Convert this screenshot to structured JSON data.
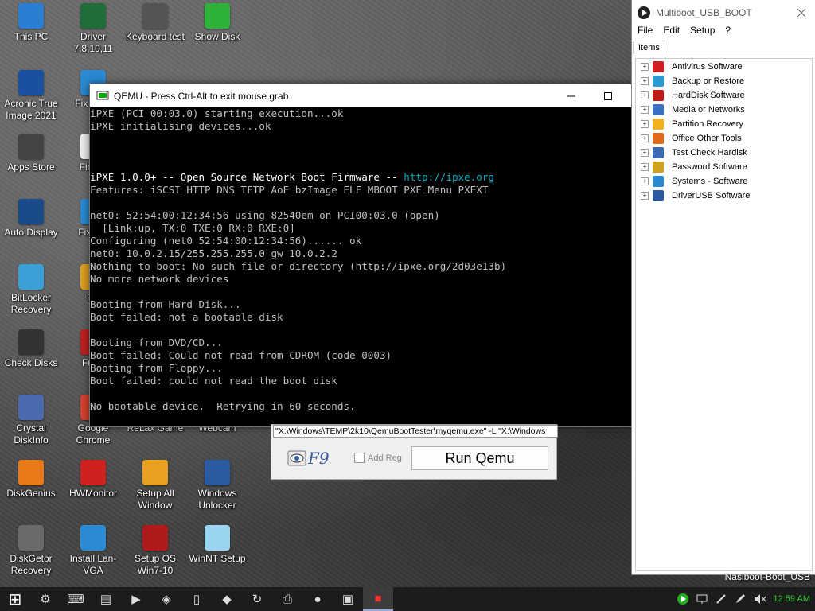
{
  "desktop_icons": [
    {
      "label": "This PC",
      "icon": "computer-icon",
      "color": "#2a7fd4"
    },
    {
      "label": "Driver 7,8,10,11",
      "icon": "driver-icon",
      "color": "#1f6e3a"
    },
    {
      "label": "Keyboard test",
      "icon": "keyboard-test-icon",
      "color": "#555555"
    },
    {
      "label": "Show Disk",
      "icon": "refresh-icon",
      "color": "#2db33a"
    },
    {
      "label": "Acronic True Image 2021",
      "icon": "acronis-icon",
      "color": "#1b4fa0"
    },
    {
      "label": "Fix D Sy",
      "icon": "fix-icon",
      "color": "#2a8ad4"
    },
    {
      "label": "Apps Store",
      "icon": "store-icon",
      "color": "#444444"
    },
    {
      "label": "Fix_ID",
      "icon": "fix-id-icon",
      "color": "#eeeeee"
    },
    {
      "label": "Auto Display",
      "icon": "display-icon",
      "color": "#1a4a8a"
    },
    {
      "label": "Fix MB",
      "icon": "fix-mb-icon",
      "color": "#2a8ad4"
    },
    {
      "label": "BitLocker Recovery",
      "icon": "bitlocker-icon",
      "color": "#3aa0d8"
    },
    {
      "label": "Fix",
      "icon": "fix-chrome-icon",
      "color": "#e0a020"
    },
    {
      "label": "Check Disks",
      "icon": "warning-icon",
      "color": "#333333"
    },
    {
      "label": "FurM",
      "icon": "furmark-icon",
      "color": "#c02020"
    },
    {
      "label": "Crystal DiskInfo",
      "icon": "crystal-icon",
      "color": "#4a6ab0"
    },
    {
      "label": "Google Chrome",
      "icon": "chrome-icon",
      "color": "#d94030"
    },
    {
      "label": "ReLax Game",
      "icon": "game-icon",
      "color": "#555555"
    },
    {
      "label": "Webcam",
      "icon": "webcam-icon",
      "color": "#555555"
    },
    {
      "label": "DiskGenius",
      "icon": "diskgenius-icon",
      "color": "#e87a1a"
    },
    {
      "label": "HWMonitor",
      "icon": "hwmonitor-icon",
      "color": "#d02020"
    },
    {
      "label": "Setup All Window",
      "icon": "setup-window-icon",
      "color": "#e8a020"
    },
    {
      "label": "Windows Unlocker",
      "icon": "unlocker-icon",
      "color": "#2a5aa0"
    },
    {
      "label": "DiskGetor Recovery",
      "icon": "diskgetor-icon",
      "color": "#6a6a6a"
    },
    {
      "label": "Install Lan-VGA",
      "icon": "wifi-icon",
      "color": "#2a8ad4"
    },
    {
      "label": "Setup OS Win7-10",
      "icon": "setup-os-icon",
      "color": "#b01a1a"
    },
    {
      "label": "WinNT Setup",
      "icon": "winnt-icon",
      "color": "#9ad4f0"
    }
  ],
  "qemu": {
    "title": "QEMU - Press Ctrl-Alt to exit mouse grab",
    "console": [
      {
        "text": "iPXE (PCI 00:03.0) starting execution...ok"
      },
      {
        "text": "iPXE initialising devices...ok"
      },
      {
        "text": ""
      },
      {
        "text": ""
      },
      {
        "text": ""
      },
      {
        "text": "iPXE 1.0.0+ -- Open Source Network Boot Firmware -- ",
        "link": "http://ipxe.org"
      },
      {
        "text": "Features: iSCSI HTTP DNS TFTP AoE bzImage ELF MBOOT PXE Menu PXEXT"
      },
      {
        "text": ""
      },
      {
        "text": "net0: 52:54:00:12:34:56 using 82540em on PCI00:03.0 (open)"
      },
      {
        "text": "  [Link:up, TX:0 TXE:0 RX:0 RXE:0]"
      },
      {
        "text": "Configuring (net0 52:54:00:12:34:56)...... ok"
      },
      {
        "text": "net0: 10.0.2.15/255.255.255.0 gw 10.0.2.2"
      },
      {
        "text": "Nothing to boot: No such file or directory (http://ipxe.org/2d03e13b)"
      },
      {
        "text": "No more network devices"
      },
      {
        "text": ""
      },
      {
        "text": "Booting from Hard Disk..."
      },
      {
        "text": "Boot failed: not a bootable disk"
      },
      {
        "text": ""
      },
      {
        "text": "Booting from DVD/CD..."
      },
      {
        "text": "Boot failed: Could not read from CDROM (code 0003)"
      },
      {
        "text": "Booting from Floppy..."
      },
      {
        "text": "Boot failed: could not read the boot disk"
      },
      {
        "text": ""
      },
      {
        "text": "No bootable device.  Retrying in 60 seconds."
      }
    ]
  },
  "launcher": {
    "cmdline": "\"X:\\Windows\\TEMP\\2k10\\QemuBootTester\\myqemu.exe\" -L \"X:\\Windows",
    "f9_label": "F9",
    "add_reg_label": "Add Reg",
    "run_button": "Run Qemu"
  },
  "multiboot": {
    "title": "Multiboot_USB_BOOT",
    "menu": [
      "File",
      "Edit",
      "Setup",
      "?"
    ],
    "tab": "Items",
    "items": [
      {
        "label": "Antivirus Software",
        "color": "#d02020"
      },
      {
        "label": "Backup or Restore",
        "color": "#2a9ad0"
      },
      {
        "label": "HardDisk Software",
        "color": "#c01a1a"
      },
      {
        "label": "Media or Networks",
        "color": "#3a70c0"
      },
      {
        "label": "Partition Recovery",
        "color": "#f0b020"
      },
      {
        "label": "Office Other Tools",
        "color": "#e06a1a"
      },
      {
        "label": "Test Check Hardisk",
        "color": "#3a6ab0"
      },
      {
        "label": "Password Software",
        "color": "#d0a020"
      },
      {
        "label": "Systems - Software",
        "color": "#2a8ad0"
      },
      {
        "label": "DriverUSB Software",
        "color": "#2a5aa0"
      }
    ],
    "footer": "Nasiboot-Boot_USB"
  },
  "taskbar": {
    "apps": [
      "start-icon",
      "hardware-icon",
      "keyboard-icon",
      "folder-icon",
      "media-icon",
      "network-icon",
      "file-icon",
      "shield-icon",
      "refresh-icon",
      "printer-icon",
      "recorder-icon",
      "monitor-icon",
      "qemu-icon"
    ],
    "clock": "12:59 AM"
  }
}
